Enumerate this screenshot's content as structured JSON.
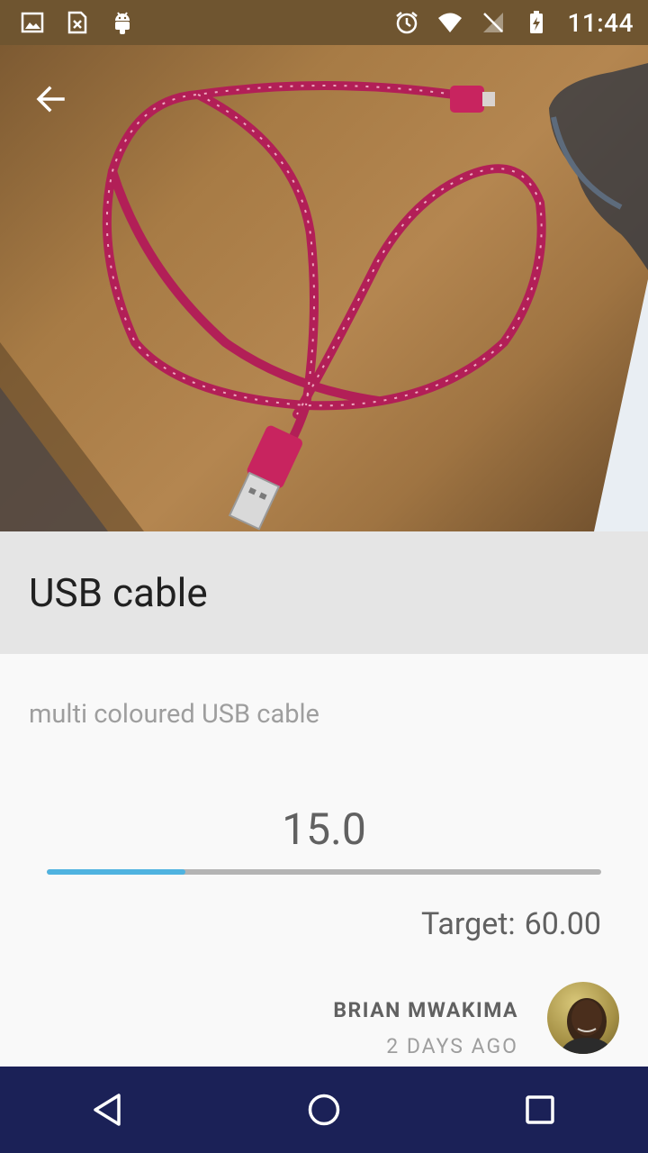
{
  "status_bar": {
    "time": "11:44",
    "left_icons": [
      "image-icon",
      "sim-card-icon",
      "android-icon"
    ],
    "right_icons": [
      "alarm-icon",
      "wifi-icon",
      "no-signal-icon",
      "battery-charging-icon"
    ]
  },
  "item": {
    "title": "USB cable",
    "description": "multi coloured USB cable",
    "amount": "15.0",
    "target_label": "Target:",
    "target_value": "60.00",
    "progress_fraction": 0.25
  },
  "author": {
    "name": "BRIAN MWAKIMA",
    "time_ago": "2 DAYS AGO"
  },
  "navigation": {
    "back_icon": "arrow-back-icon",
    "buttons": [
      "nav-back-icon",
      "nav-home-icon",
      "nav-recents-icon"
    ]
  },
  "colors": {
    "status_bar": "#6f5530",
    "title_band": "#e5e5e5",
    "progress_fill": "#4fb3e0",
    "progress_track": "#b4b4b4",
    "nav_bar": "#1b2157"
  }
}
